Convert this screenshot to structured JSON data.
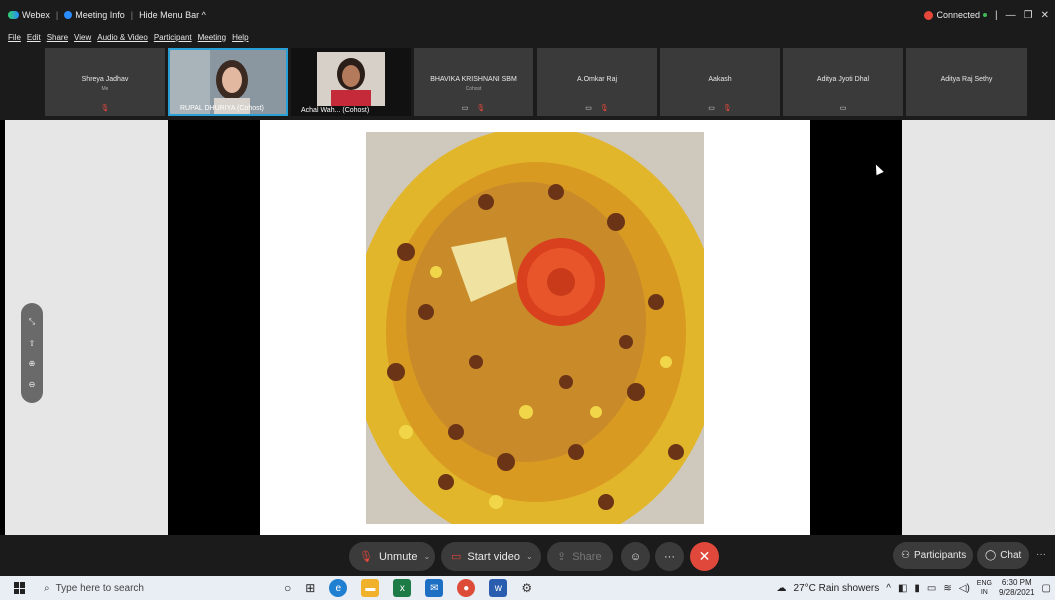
{
  "titlebar": {
    "app": "Webex",
    "meeting_info": "Meeting Info",
    "hide_menu": "Hide Menu Bar ^",
    "status": "Connected",
    "sep": "|",
    "minimize": "—",
    "restore": "❐",
    "close": "✕",
    "status_icon": "●"
  },
  "menu": [
    "File",
    "Edit",
    "Share",
    "View",
    "Audio & Video",
    "Participant",
    "Meeting",
    "Help"
  ],
  "participants": [
    {
      "name": "Shreya Jadhav",
      "sub": "Me",
      "video": false
    },
    {
      "name": "RUPAL DHURIYA  (Cohost)",
      "video": true
    },
    {
      "name": "Achal Wah...  (Cohost)",
      "video": true
    },
    {
      "name": "BHAVIKA KRISHNANI SBM",
      "sub": "Cohost",
      "video": false
    },
    {
      "name": "A.Omkar Raj",
      "video": false
    },
    {
      "name": "Aakash",
      "video": false
    },
    {
      "name": "Aditya Jyoti Dhal",
      "video": false
    },
    {
      "name": "Aditya Raj Sethy",
      "video": false
    }
  ],
  "controls": {
    "unmute": "Unmute",
    "start_video": "Start video",
    "share": "Share",
    "participants": "Participants",
    "chat": "Chat",
    "more": "···",
    "end": "✕",
    "reactions": "☺",
    "chevron": "⌄"
  },
  "taskbar": {
    "search_placeholder": "Type here to search",
    "weather": "27°C  Rain showers",
    "lang1": "ENG",
    "lang2": "IN",
    "time": "6:30 PM",
    "date": "9/28/2021"
  },
  "colors": {
    "end_call": "#e0483b",
    "accent": "#2a8cff"
  }
}
